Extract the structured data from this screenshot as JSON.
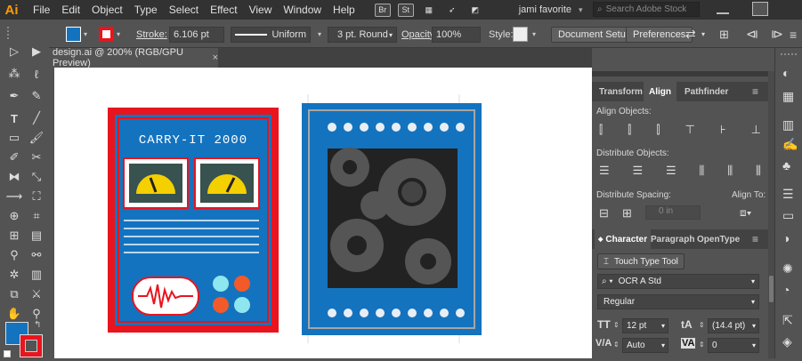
{
  "app": {
    "logo": "Ai"
  },
  "menu": [
    "File",
    "Edit",
    "Object",
    "Type",
    "Select",
    "Effect",
    "View",
    "Window",
    "Help"
  ],
  "menu_badges": [
    "Br",
    "St"
  ],
  "workspace": {
    "name": "jami favorite"
  },
  "search": {
    "placeholder": "Search Adobe Stock"
  },
  "control_bar": {
    "stroke_label": "Stroke:",
    "stroke_value": "6.106 pt",
    "profile_label": "Uniform",
    "brush_label": "3 pt. Round",
    "opacity_label": "Opacity:",
    "opacity_value": "100%",
    "style_label": "Style:",
    "doc_setup": "Document Setup",
    "preferences": "Preferences"
  },
  "document_tab": {
    "title": "design.ai @ 200% (RGB/GPU Preview)",
    "close": "×"
  },
  "artwork": {
    "left_title": "CARRY-IT 2000",
    "colors": {
      "red": "#e8141e",
      "blue": "#1473be",
      "dark": "#222222",
      "gear": "#555555",
      "yellow": "#f4d000",
      "teal": "#8ee6ee",
      "orange": "#f25a2a"
    }
  },
  "panel_top": {
    "tabs": [
      "Transform",
      "Align",
      "Pathfinder"
    ],
    "align_objects": "Align Objects:",
    "distribute_objects": "Distribute Objects:",
    "distribute_spacing": "Distribute Spacing:",
    "align_to": "Align To:",
    "spacing_value": "0 in"
  },
  "panel_char": {
    "tabs": [
      "Character",
      "Paragraph",
      "OpenType"
    ],
    "touch_type": "Touch Type Tool",
    "font_family": "OCR A Std",
    "font_style": "Regular",
    "size": "12 pt",
    "leading": "(14.4 pt)",
    "kerning": "Auto",
    "tracking": "0"
  }
}
